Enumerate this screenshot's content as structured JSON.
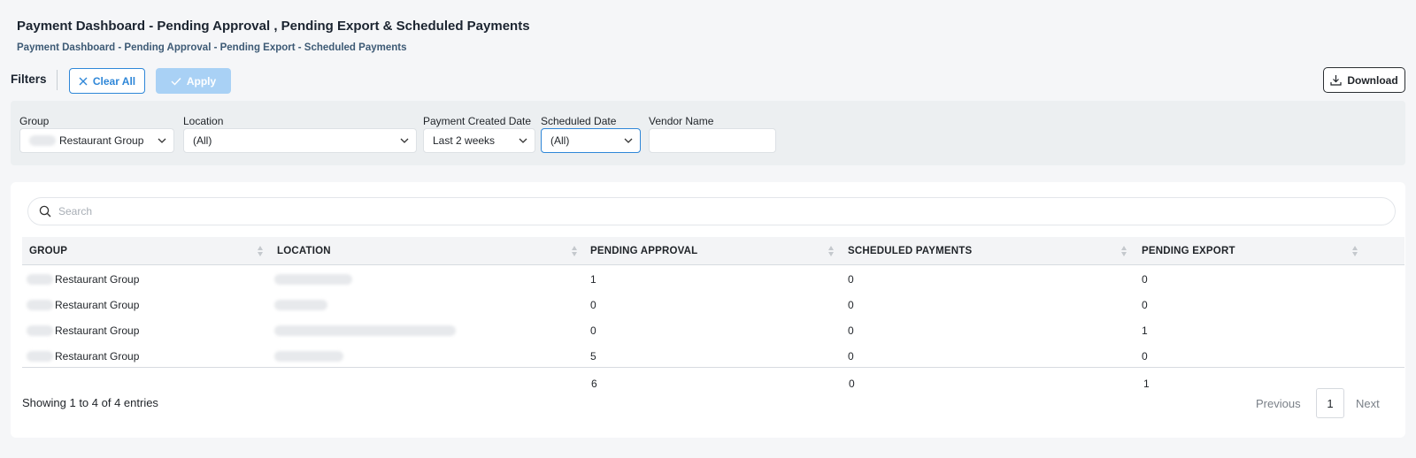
{
  "page": {
    "title": "Payment Dashboard - Pending Approval , Pending Export & Scheduled Payments",
    "breadcrumb": "Payment Dashboard - Pending Approval - Pending Export - Scheduled Payments"
  },
  "toolbar": {
    "filters_label": "Filters",
    "clear_all_label": "Clear All",
    "apply_label": "Apply",
    "download_label": "Download"
  },
  "filters": {
    "group": {
      "label": "Group",
      "value": "Restaurant Group"
    },
    "location": {
      "label": "Location",
      "value": "(All)"
    },
    "payment_created_date": {
      "label": "Payment Created Date",
      "value": "Last 2 weeks"
    },
    "scheduled_date": {
      "label": "Scheduled Date",
      "value": "(All)"
    },
    "vendor_name": {
      "label": "Vendor Name",
      "value": ""
    }
  },
  "table": {
    "search_placeholder": "Search",
    "columns": [
      "GROUP",
      "LOCATION",
      "PENDING APPROVAL",
      "SCHEDULED PAYMENTS",
      "PENDING EXPORT"
    ],
    "rows": [
      {
        "group": "Restaurant Group",
        "pending_approval": "1",
        "scheduled_payments": "0",
        "pending_export": "0"
      },
      {
        "group": "Restaurant Group",
        "pending_approval": "0",
        "scheduled_payments": "0",
        "pending_export": "0"
      },
      {
        "group": "Restaurant Group",
        "pending_approval": "0",
        "scheduled_payments": "0",
        "pending_export": "1"
      },
      {
        "group": "Restaurant Group",
        "pending_approval": "5",
        "scheduled_payments": "0",
        "pending_export": "0"
      }
    ],
    "totals": {
      "pending_approval": "6",
      "scheduled_payments": "0",
      "pending_export": "1"
    }
  },
  "pagination": {
    "summary": "Showing 1 to 4 of 4 entries",
    "previous_label": "Previous",
    "current_page": "1",
    "next_label": "Next"
  },
  "colors": {
    "accent": "#2f87d8",
    "apply_disabled": "#a9d1f5",
    "background": "#f5f6f8",
    "filter_panel": "#eceff1"
  }
}
